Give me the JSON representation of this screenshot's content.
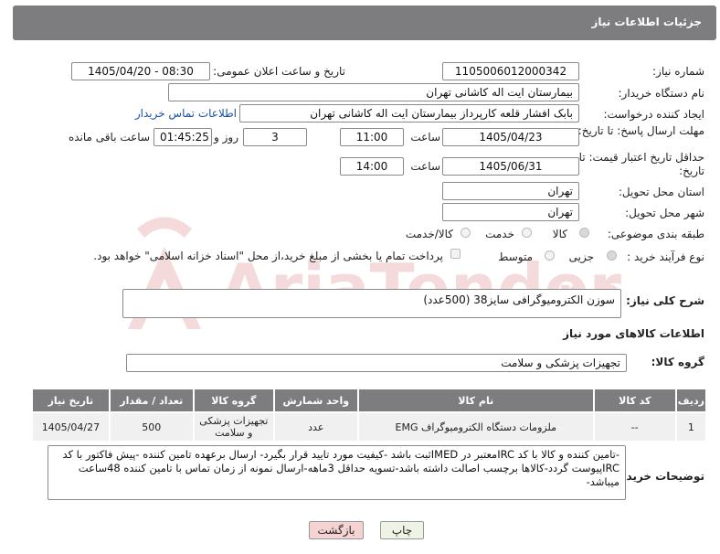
{
  "header": {
    "title": "جزئیات اطلاعات نیاز"
  },
  "need_number": {
    "label": "شماره نیاز:",
    "value": "1105006012000342"
  },
  "announce_date": {
    "label": "تاریخ و ساعت اعلان عمومی:",
    "value": "1405/04/20 - 08:30"
  },
  "buyer_org": {
    "label": "نام دستگاه خریدار:",
    "value": "بیمارستان ایت اله کاشانی تهران"
  },
  "requester": {
    "label": "ایجاد کننده درخواست:",
    "value": "بابک افشار قلعه کارپرداز بیمارستان ایت اله کاشانی تهران",
    "contact_link": "اطلاعات تماس خریدار"
  },
  "deadline": {
    "label": "مهلت ارسال پاسخ: تا تاریخ:",
    "date": "1405/04/23",
    "time_label": "ساعت",
    "time": "11:00",
    "days": "3",
    "days_label": "روز و",
    "remaining": "01:45:25",
    "remaining_label": "ساعت باقی مانده"
  },
  "validity": {
    "label": "حداقل تاریخ اعتبار قیمت: تا تاریخ:",
    "date": "1405/06/31",
    "time_label": "ساعت",
    "time": "14:00"
  },
  "province": {
    "label": "استان محل تحویل:",
    "value": "تهران"
  },
  "city": {
    "label": "شهر محل تحویل:",
    "value": "تهران"
  },
  "category": {
    "label": "طبقه بندی موضوعی:",
    "options": [
      "کالا",
      "خدمت",
      "کالا/خدمت"
    ],
    "selected": "کالا"
  },
  "process": {
    "label": "نوع فرآیند خرید :",
    "options": [
      "جزیی",
      "متوسط"
    ],
    "selected": "جزیی",
    "payment_note": "پرداخت تمام یا بخشی از مبلغ خرید،از محل \"اسناد خزانه اسلامی\" خواهد بود."
  },
  "summary": {
    "label": "شرح کلی نیاز:",
    "value": "سوزن الکترومیوگرافی سایز38 (500عدد)"
  },
  "goods_info": {
    "title": "اطلاعات کالاهای مورد نیاز"
  },
  "goods_group": {
    "label": "گروه کالا:",
    "value": "تجهیزات پزشکی و سلامت"
  },
  "table": {
    "headers": [
      "ردیف",
      "کد کالا",
      "نام کالا",
      "واحد شمارش",
      "گروه کالا",
      "تعداد / مقدار",
      "تاریخ نیاز"
    ],
    "rows": [
      [
        "1",
        "--",
        "ملزومات دستگاه الکترومیوگراف EMG",
        "عدد",
        "تجهیزات پزشکی و سلامت",
        "500",
        "1405/04/27"
      ]
    ]
  },
  "buyer_notes": {
    "label": "توضیحات خریدار:",
    "value": "-تامین کننده و کالا با کد IRCمعتبر در IMEDثبت باشد -کیفیت مورد تایید قرار بگیرد- ارسال برعهده تامین کننده -پیش فاکتور با کد IRCپیوست گردد-کالاها برچسب اصالت داشته باشد-تسویه حداقل 3ماهه-ارسال نمونه از زمان تماس با تامین کننده 48ساعت میباشد-"
  },
  "buttons": {
    "print": "چاپ",
    "back": "بازگشت"
  },
  "colors": {
    "header": "#7d7d80",
    "link": "#1a4fa0",
    "back_button": "#f6d3d3",
    "print_button": "#eef4e3"
  }
}
